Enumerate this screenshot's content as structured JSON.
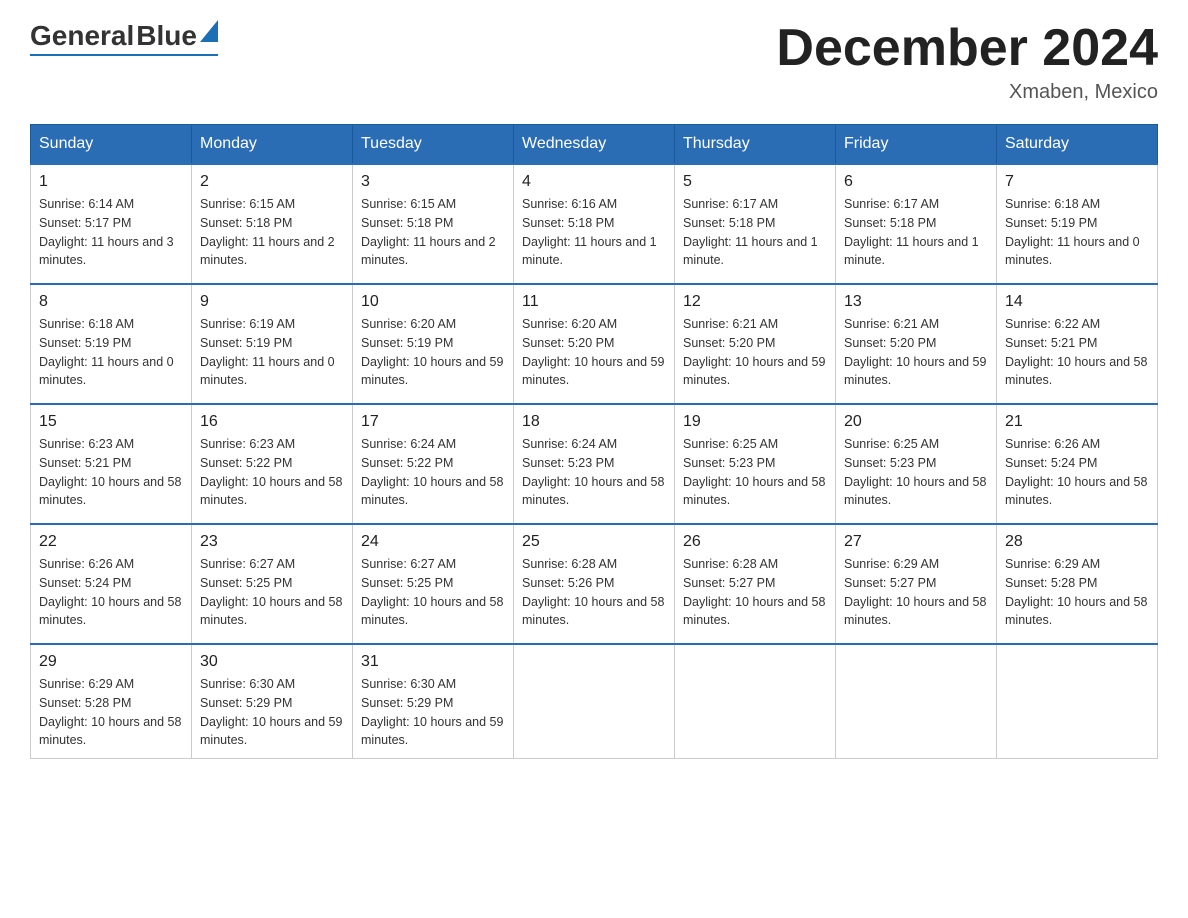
{
  "header": {
    "logo": {
      "general": "General",
      "blue": "Blue"
    },
    "title": "December 2024",
    "location": "Xmaben, Mexico"
  },
  "weekdays": [
    "Sunday",
    "Monday",
    "Tuesday",
    "Wednesday",
    "Thursday",
    "Friday",
    "Saturday"
  ],
  "weeks": [
    [
      {
        "day": "1",
        "sunrise": "6:14 AM",
        "sunset": "5:17 PM",
        "daylight": "11 hours and 3 minutes."
      },
      {
        "day": "2",
        "sunrise": "6:15 AM",
        "sunset": "5:18 PM",
        "daylight": "11 hours and 2 minutes."
      },
      {
        "day": "3",
        "sunrise": "6:15 AM",
        "sunset": "5:18 PM",
        "daylight": "11 hours and 2 minutes."
      },
      {
        "day": "4",
        "sunrise": "6:16 AM",
        "sunset": "5:18 PM",
        "daylight": "11 hours and 1 minute."
      },
      {
        "day": "5",
        "sunrise": "6:17 AM",
        "sunset": "5:18 PM",
        "daylight": "11 hours and 1 minute."
      },
      {
        "day": "6",
        "sunrise": "6:17 AM",
        "sunset": "5:18 PM",
        "daylight": "11 hours and 1 minute."
      },
      {
        "day": "7",
        "sunrise": "6:18 AM",
        "sunset": "5:19 PM",
        "daylight": "11 hours and 0 minutes."
      }
    ],
    [
      {
        "day": "8",
        "sunrise": "6:18 AM",
        "sunset": "5:19 PM",
        "daylight": "11 hours and 0 minutes."
      },
      {
        "day": "9",
        "sunrise": "6:19 AM",
        "sunset": "5:19 PM",
        "daylight": "11 hours and 0 minutes."
      },
      {
        "day": "10",
        "sunrise": "6:20 AM",
        "sunset": "5:19 PM",
        "daylight": "10 hours and 59 minutes."
      },
      {
        "day": "11",
        "sunrise": "6:20 AM",
        "sunset": "5:20 PM",
        "daylight": "10 hours and 59 minutes."
      },
      {
        "day": "12",
        "sunrise": "6:21 AM",
        "sunset": "5:20 PM",
        "daylight": "10 hours and 59 minutes."
      },
      {
        "day": "13",
        "sunrise": "6:21 AM",
        "sunset": "5:20 PM",
        "daylight": "10 hours and 59 minutes."
      },
      {
        "day": "14",
        "sunrise": "6:22 AM",
        "sunset": "5:21 PM",
        "daylight": "10 hours and 58 minutes."
      }
    ],
    [
      {
        "day": "15",
        "sunrise": "6:23 AM",
        "sunset": "5:21 PM",
        "daylight": "10 hours and 58 minutes."
      },
      {
        "day": "16",
        "sunrise": "6:23 AM",
        "sunset": "5:22 PM",
        "daylight": "10 hours and 58 minutes."
      },
      {
        "day": "17",
        "sunrise": "6:24 AM",
        "sunset": "5:22 PM",
        "daylight": "10 hours and 58 minutes."
      },
      {
        "day": "18",
        "sunrise": "6:24 AM",
        "sunset": "5:23 PM",
        "daylight": "10 hours and 58 minutes."
      },
      {
        "day": "19",
        "sunrise": "6:25 AM",
        "sunset": "5:23 PM",
        "daylight": "10 hours and 58 minutes."
      },
      {
        "day": "20",
        "sunrise": "6:25 AM",
        "sunset": "5:23 PM",
        "daylight": "10 hours and 58 minutes."
      },
      {
        "day": "21",
        "sunrise": "6:26 AM",
        "sunset": "5:24 PM",
        "daylight": "10 hours and 58 minutes."
      }
    ],
    [
      {
        "day": "22",
        "sunrise": "6:26 AM",
        "sunset": "5:24 PM",
        "daylight": "10 hours and 58 minutes."
      },
      {
        "day": "23",
        "sunrise": "6:27 AM",
        "sunset": "5:25 PM",
        "daylight": "10 hours and 58 minutes."
      },
      {
        "day": "24",
        "sunrise": "6:27 AM",
        "sunset": "5:25 PM",
        "daylight": "10 hours and 58 minutes."
      },
      {
        "day": "25",
        "sunrise": "6:28 AM",
        "sunset": "5:26 PM",
        "daylight": "10 hours and 58 minutes."
      },
      {
        "day": "26",
        "sunrise": "6:28 AM",
        "sunset": "5:27 PM",
        "daylight": "10 hours and 58 minutes."
      },
      {
        "day": "27",
        "sunrise": "6:29 AM",
        "sunset": "5:27 PM",
        "daylight": "10 hours and 58 minutes."
      },
      {
        "day": "28",
        "sunrise": "6:29 AM",
        "sunset": "5:28 PM",
        "daylight": "10 hours and 58 minutes."
      }
    ],
    [
      {
        "day": "29",
        "sunrise": "6:29 AM",
        "sunset": "5:28 PM",
        "daylight": "10 hours and 58 minutes."
      },
      {
        "day": "30",
        "sunrise": "6:30 AM",
        "sunset": "5:29 PM",
        "daylight": "10 hours and 59 minutes."
      },
      {
        "day": "31",
        "sunrise": "6:30 AM",
        "sunset": "5:29 PM",
        "daylight": "10 hours and 59 minutes."
      },
      null,
      null,
      null,
      null
    ]
  ]
}
